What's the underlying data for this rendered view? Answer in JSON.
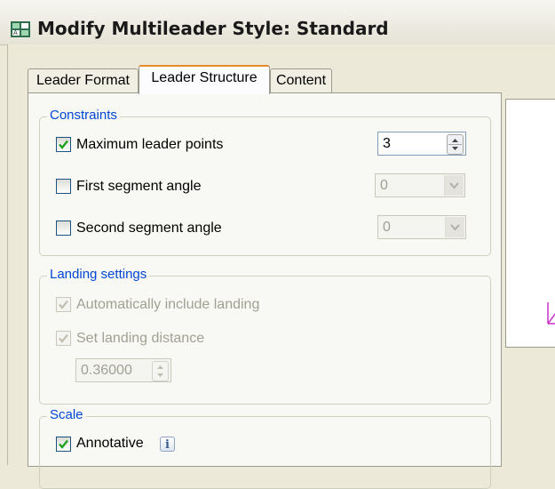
{
  "window": {
    "title": "Modify Multileader Style: Standard"
  },
  "tabs": [
    {
      "label": "Leader Format"
    },
    {
      "label": "Leader Structure",
      "active": true
    },
    {
      "label": "Content"
    }
  ],
  "constraints": {
    "legend": "Constraints",
    "max_leader_points": {
      "label": "Maximum leader points",
      "checked": true,
      "value": "3"
    },
    "first_segment_angle": {
      "label": "First segment angle",
      "checked": false,
      "value": "0"
    },
    "second_segment_angle": {
      "label": "Second segment angle",
      "checked": false,
      "value": "0"
    }
  },
  "landing": {
    "legend": "Landing settings",
    "auto_include": {
      "label": "Automatically include landing",
      "checked": true,
      "enabled": false
    },
    "set_distance": {
      "label": "Set landing distance",
      "checked": true,
      "enabled": false
    },
    "distance_value": "0.36000"
  },
  "scale": {
    "legend": "Scale",
    "annotative": {
      "label": "Annotative",
      "checked": true
    },
    "info_glyph": "i"
  },
  "icons": {
    "app": "multileader-style-icon",
    "info": "info-icon"
  },
  "colors": {
    "group_legend": "#0046d5",
    "active_tab_accent": "#e68b2c",
    "highlight_box": "#d42020",
    "preview_mark": "#cc33cc"
  }
}
